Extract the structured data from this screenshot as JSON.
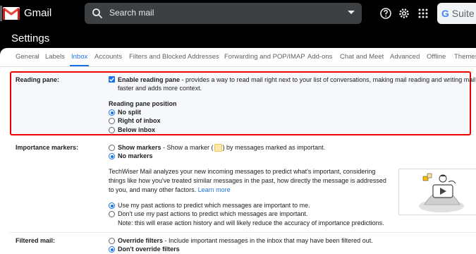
{
  "app": {
    "name": "Gmail",
    "brand_red": "#ea4335",
    "accent": "#1a73e8"
  },
  "search": {
    "placeholder": "Search mail"
  },
  "header": {
    "gsuite_g": "G",
    "gsuite_text": "Suite"
  },
  "page": {
    "title": "Settings"
  },
  "tabs": [
    {
      "label": "General"
    },
    {
      "label": "Labels"
    },
    {
      "label": "Inbox",
      "active": true
    },
    {
      "label": "Accounts"
    },
    {
      "label": "Filters and Blocked Addresses"
    },
    {
      "label": "Forwarding and POP/IMAP"
    },
    {
      "label": "Add-ons"
    },
    {
      "label": "Chat and Meet"
    },
    {
      "label": "Advanced"
    },
    {
      "label": "Offline"
    },
    {
      "label": "Themes"
    }
  ],
  "reading_pane": {
    "label": "Reading pane:",
    "enable_label": "Enable reading pane",
    "enable_desc_1": " - provides a way to read mail right next to your list of conversations, making mail reading and writing mail",
    "enable_desc_2": "faster and adds more context.",
    "enabled": true,
    "position_heading": "Reading pane position",
    "options": [
      {
        "label": "No split",
        "checked": true
      },
      {
        "label": "Right of inbox",
        "checked": false
      },
      {
        "label": "Below inbox",
        "checked": false
      }
    ]
  },
  "importance": {
    "label": "Importance markers:",
    "show_label": "Show markers",
    "show_desc_pre": " - Show a marker (",
    "show_desc_post": ") by messages marked as important.",
    "no_markers_label": "No markers",
    "info_1": "TechWiser Mail analyzes your new incoming messages to predict what's important, considering",
    "info_2": "things like how you've treated similar messages in the past, how directly the message is addressed",
    "info_3": "to you, and many other factors.",
    "learn_more": "Learn more",
    "past_actions_use": "Use my past actions to predict which messages are important to me.",
    "past_actions_dont": "Don't use my past actions to predict which messages are important.",
    "note": "Note: this will erase action history and will likely reduce the accuracy of importance predictions."
  },
  "filtered": {
    "label": "Filtered mail:",
    "override_label": "Override filters",
    "override_desc": " - Include important messages in the inbox that may have been filtered out.",
    "dont_override_label": "Don't override filters"
  }
}
